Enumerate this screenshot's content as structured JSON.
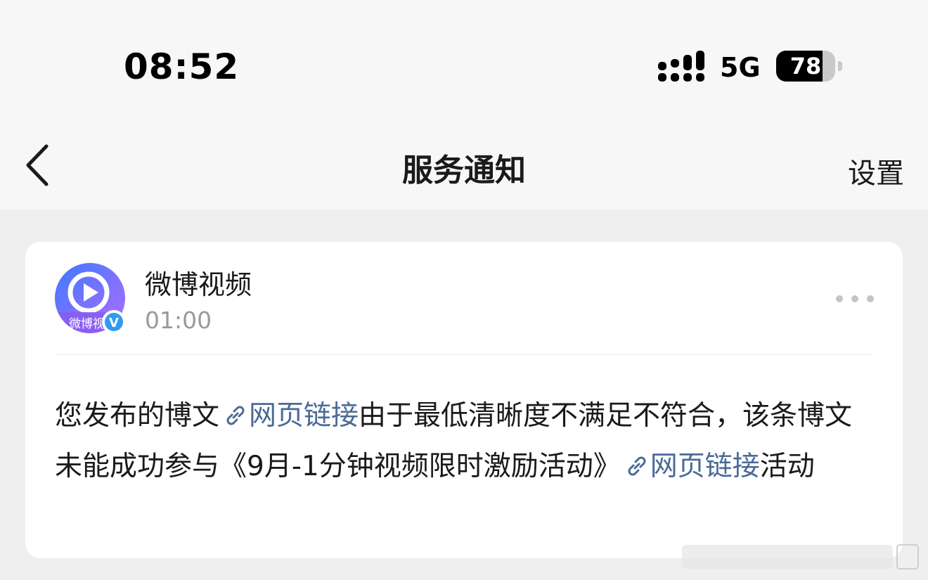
{
  "status_bar": {
    "time": "08:52",
    "network": "5G",
    "battery_level": "78",
    "battery_fraction": 0.78
  },
  "nav": {
    "back_icon": "chevron-left-icon",
    "title": "服务通知",
    "settings_label": "设置"
  },
  "notification": {
    "sender": "微博视频",
    "avatar_label": "微博视",
    "verified_mark": "V",
    "time": "01:00",
    "more_icon": "more-dots-icon",
    "body": {
      "part1": "您发布的博文",
      "link1": "网页链接",
      "part2": "由于最低清晰度不满足不符合，该条博文未能成功参与《9月-1分钟视频限时激励活动》",
      "link2": "网页链接",
      "part3": "活动"
    }
  },
  "colors": {
    "link": "#4a6b96",
    "background": "#f7f7f7",
    "content_background": "#efefef",
    "card": "#ffffff",
    "avatar_gradient": [
      "#3b7bff",
      "#b36bff"
    ],
    "verified_badge": "#2e9bf0"
  }
}
